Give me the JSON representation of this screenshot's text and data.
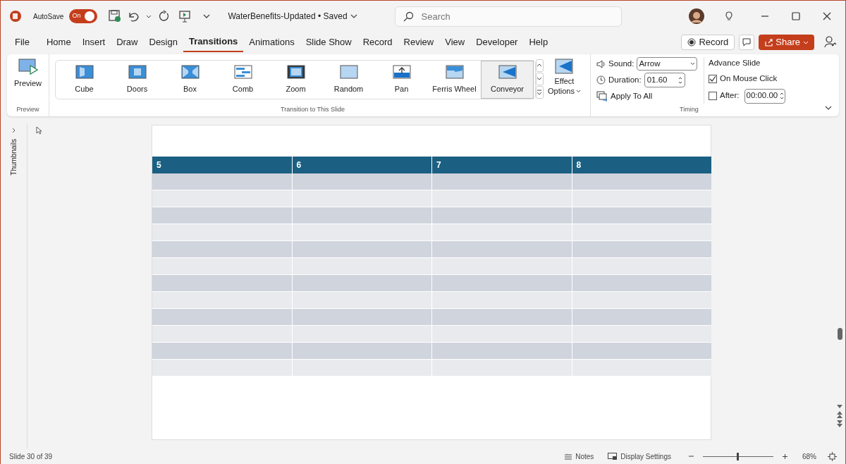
{
  "title_bar": {
    "autosave_label": "AutoSave",
    "autosave_toggle": {
      "label": "On",
      "on": true
    },
    "document_title": "WaterBenefits-Updated • Saved",
    "search": {
      "placeholder": "Search"
    }
  },
  "tabs": [
    {
      "label": "File",
      "selected": false
    },
    {
      "label": "Home",
      "selected": false
    },
    {
      "label": "Insert",
      "selected": false
    },
    {
      "label": "Draw",
      "selected": false
    },
    {
      "label": "Design",
      "selected": false
    },
    {
      "label": "Transitions",
      "selected": true
    },
    {
      "label": "Animations",
      "selected": false
    },
    {
      "label": "Slide Show",
      "selected": false
    },
    {
      "label": "Record",
      "selected": false
    },
    {
      "label": "Review",
      "selected": false
    },
    {
      "label": "View",
      "selected": false
    },
    {
      "label": "Developer",
      "selected": false
    },
    {
      "label": "Help",
      "selected": false
    }
  ],
  "record_button": "Record",
  "share_button": "Share",
  "ribbon": {
    "preview": {
      "button": "Preview",
      "group_label": "Preview"
    },
    "transitions": [
      {
        "label": "Cube",
        "selected": false
      },
      {
        "label": "Doors",
        "selected": false
      },
      {
        "label": "Box",
        "selected": false
      },
      {
        "label": "Comb",
        "selected": false
      },
      {
        "label": "Zoom",
        "selected": false
      },
      {
        "label": "Random",
        "selected": false
      },
      {
        "label": "Pan",
        "selected": false
      },
      {
        "label": "Ferris Wheel",
        "selected": false
      },
      {
        "label": "Conveyor",
        "selected": true
      }
    ],
    "effect_options": [
      "Effect",
      "Options"
    ],
    "gallery_label": "Transition to This Slide",
    "timing": {
      "sound_label": "Sound:",
      "sound_value": "Arrow",
      "duration_label": "Duration:",
      "duration_value": "01.60",
      "apply_to_all": "Apply To All",
      "group_label": "Timing"
    },
    "advance": {
      "title": "Advance Slide",
      "on_mouse_click": {
        "label": "On Mouse Click",
        "checked": true
      },
      "after": {
        "label": "After:",
        "checked": false,
        "value": "00:00.00"
      }
    }
  },
  "thumbnails_label": "Thumbnails",
  "slide_table": {
    "columns": [
      "5",
      "6",
      "7",
      "8"
    ]
  },
  "status_bar": {
    "slide": "Slide 30 of 39",
    "notes": "Notes",
    "display_settings": "Display Settings",
    "zoom": {
      "level": 0.5,
      "reading": "68%"
    }
  }
}
